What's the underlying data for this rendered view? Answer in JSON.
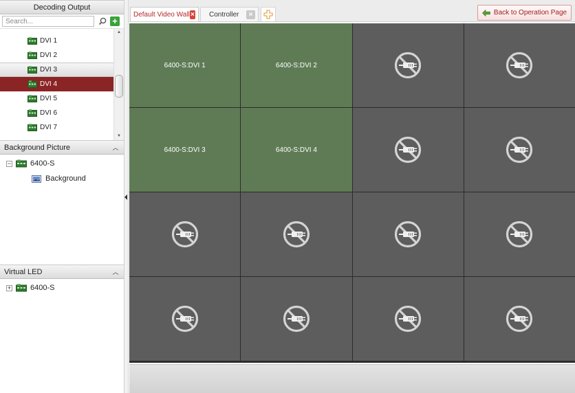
{
  "left_panel": {
    "decoding_output": {
      "title": "Decoding Output",
      "search_placeholder": "Search...",
      "items": [
        {
          "label": "DVI 1",
          "state": "normal"
        },
        {
          "label": "DVI 2",
          "state": "normal"
        },
        {
          "label": "DVI 3",
          "state": "selected"
        },
        {
          "label": "DVI 4",
          "state": "active"
        },
        {
          "label": "DVI 5",
          "state": "normal"
        },
        {
          "label": "DVI 6",
          "state": "normal"
        },
        {
          "label": "DVI 7",
          "state": "normal"
        }
      ]
    },
    "background_picture": {
      "title": "Background Picture",
      "device": "6400-S",
      "child": "Background"
    },
    "virtual_led": {
      "title": "Virtual LED",
      "device": "6400-S"
    }
  },
  "tabs": [
    {
      "label": "Default Video Wall",
      "active": true
    },
    {
      "label": "Controller",
      "active": false
    }
  ],
  "back_button_label": "Back to Operation Page",
  "wall": {
    "rows": 4,
    "cols": 4,
    "cells": [
      {
        "label": "6400-S:DVI 1"
      },
      {
        "label": "6400-S:DVI 2"
      },
      {
        "label": null
      },
      {
        "label": null
      },
      {
        "label": "6400-S:DVI 3"
      },
      {
        "label": "6400-S:DVI 4"
      },
      {
        "label": null
      },
      {
        "label": null
      },
      {
        "label": null
      },
      {
        "label": null
      },
      {
        "label": null
      },
      {
        "label": null
      },
      {
        "label": null
      },
      {
        "label": null
      },
      {
        "label": null
      },
      {
        "label": null
      }
    ]
  },
  "colors": {
    "cell_used": "#5f7b55",
    "cell_empty": "#5d5d5d",
    "active_item": "#8b2424",
    "tab_active_text": "#b52828"
  }
}
